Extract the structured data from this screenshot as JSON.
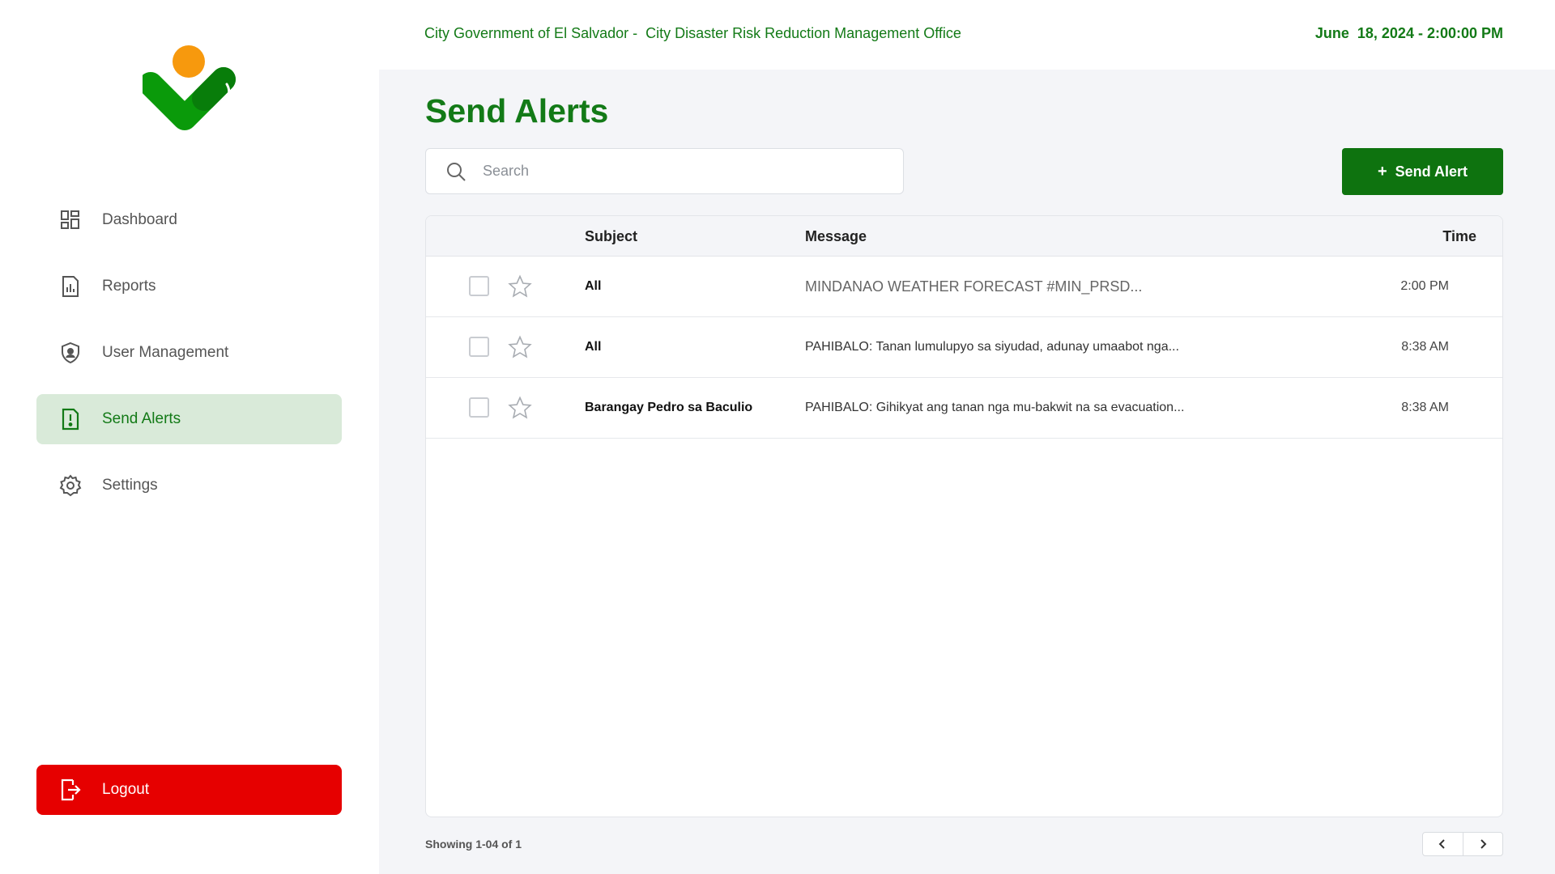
{
  "app": {
    "organization": "City Government of El Salvador -  City Disaster Risk Reduction Management Office",
    "datetime": "June  18, 2024 - 2:00:00 PM",
    "brand_color": "#137a17",
    "logo": "heart-check-logo"
  },
  "sidebar": {
    "items": [
      {
        "label": "Dashboard",
        "icon": "dashboard-icon",
        "active": false
      },
      {
        "label": "Reports",
        "icon": "report-icon",
        "active": false
      },
      {
        "label": "User Management",
        "icon": "shield-user-icon",
        "active": false
      },
      {
        "label": "Send Alerts",
        "icon": "alert-icon",
        "active": true
      },
      {
        "label": "Settings",
        "icon": "gear-icon",
        "active": false
      }
    ],
    "logout_label": "Logout"
  },
  "main": {
    "title": "Send Alerts",
    "search_placeholder": "Search",
    "send_button_label": "Send Alert",
    "send_button_plus": "+",
    "table": {
      "headers": {
        "subject": "Subject",
        "message": "Message",
        "time": "Time"
      },
      "rows": [
        {
          "subject": "All",
          "message": "MINDANAO WEATHER FORECAST #MIN_PRSD...",
          "time": "2:00 PM"
        },
        {
          "subject": "All",
          "message": "PAHIBALO: Tanan lumulupyo sa siyudad, adunay umaabot nga...",
          "time": "8:38 AM"
        },
        {
          "subject": "Barangay Pedro sa Baculio",
          "message": "PAHIBALO: Gihikyat ang tanan nga mu-bakwit na sa evacuation...",
          "time": "8:38 AM"
        }
      ]
    },
    "pagination_text": "Showing 1-04 of 1"
  }
}
